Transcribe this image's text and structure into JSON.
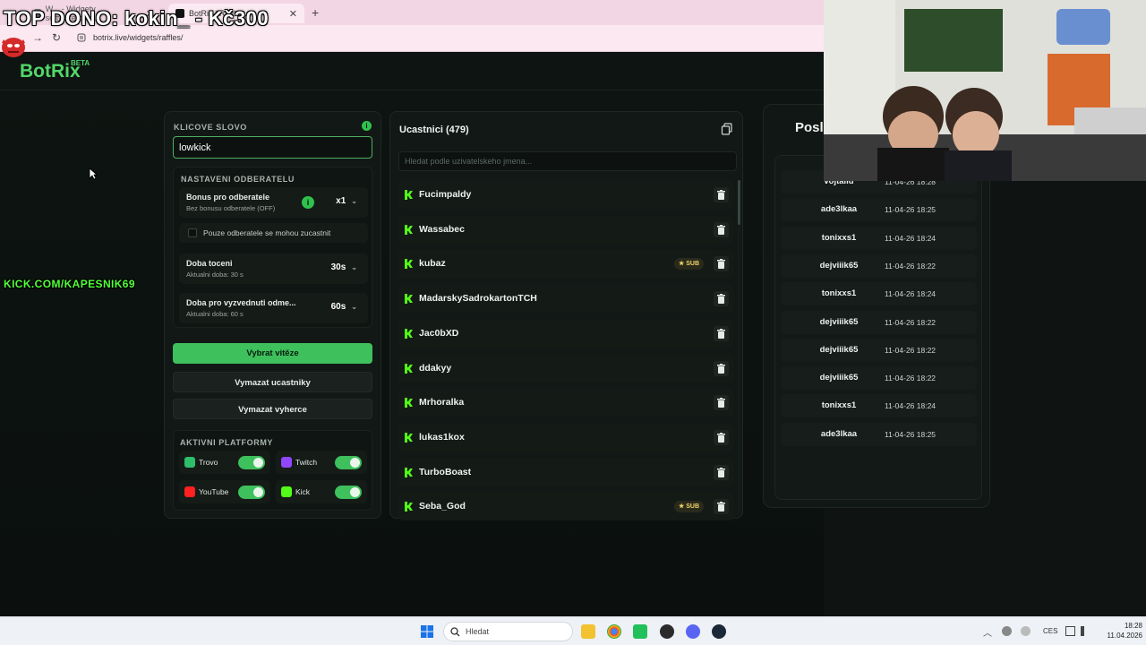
{
  "browser": {
    "tabs": [
      {
        "label": "W... - Widgety ... software pro ..."
      },
      {
        "label": "BotRix | Raffle..."
      }
    ],
    "new_tab": "+",
    "url": "botrix.live/widgets/raffles/"
  },
  "stream_overlay": {
    "top_text": "TOP DONO: kokin_ - Kč300",
    "kick_link": "KICK.COM/KAPESNIK69"
  },
  "app": {
    "logo": "BotRix",
    "beta": "BETA"
  },
  "settings": {
    "keyword_label": "KLICOVE SLOVO",
    "keyword_value": "lowkick",
    "subscriber_settings_label": "NASTAVENI ODBERATELU",
    "bonus": {
      "title": "Bonus pro odberatele",
      "subtitle": "Bez bonusu odberatele (OFF)",
      "value": "x1"
    },
    "sub_only_label": "Pouze odberatele se mohou zucastnit",
    "spin_time": {
      "title": "Doba toceni",
      "subtitle": "Aktualni doba: 30 s",
      "value": "30s"
    },
    "claim_time": {
      "title": "Doba pro vyzvednuti odme...",
      "subtitle": "Aktualni doba: 60 s",
      "value": "60s"
    },
    "pick_winner": "Vybrat vitěze",
    "clear_participants": "Vymazat ucastniky",
    "clear_winners": "Vymazat vyherce",
    "platforms_label": "AKTIVNI PLATFORMY",
    "platforms": [
      {
        "name": "Trovo",
        "color": "#2dbf6a",
        "enabled": true
      },
      {
        "name": "Twitch",
        "color": "#9146ff",
        "enabled": true
      },
      {
        "name": "YouTube",
        "color": "#ff2020",
        "enabled": true
      },
      {
        "name": "Kick",
        "color": "#53fc18",
        "enabled": true
      }
    ]
  },
  "participants": {
    "title": "Ucastnici (479)",
    "search_placeholder": "Hledat podle uzivatelskeho jmena...",
    "sub_badge": "★ SUB",
    "list": [
      {
        "name": "Fucimpaldy",
        "sub": false
      },
      {
        "name": "Wassabec",
        "sub": false
      },
      {
        "name": "kubaz",
        "sub": true
      },
      {
        "name": "MadarskySadrokartonTCH",
        "sub": false
      },
      {
        "name": "Jac0bXD",
        "sub": false
      },
      {
        "name": "ddakyy",
        "sub": false
      },
      {
        "name": "Mrhoralka",
        "sub": false
      },
      {
        "name": "lukas1kox",
        "sub": false
      },
      {
        "name": "TurboBoast",
        "sub": false
      },
      {
        "name": "Seba_God",
        "sub": true
      }
    ]
  },
  "winners": {
    "title": "Posl",
    "list": [
      {
        "name": "vojtalid",
        "time": "11-04-26 18:28"
      },
      {
        "name": "ade3lkaa",
        "time": "11-04-26 18:25"
      },
      {
        "name": "tonixxs1",
        "time": "11-04-26 18:24"
      },
      {
        "name": "dejviiik65",
        "time": "11-04-26 18:22"
      },
      {
        "name": "tonixxs1",
        "time": "11-04-26 18:24"
      },
      {
        "name": "dejviiik65",
        "time": "11-04-26 18:22"
      },
      {
        "name": "dejviiik65",
        "time": "11-04-26 18:22"
      },
      {
        "name": "dejviiik65",
        "time": "11-04-26 18:22"
      },
      {
        "name": "tonixxs1",
        "time": "11-04-26 18:24"
      },
      {
        "name": "ade3lkaa",
        "time": "11-04-26 18:25"
      }
    ]
  },
  "taskbar": {
    "search_text": "Hledat",
    "language": "CES",
    "time": "18:28",
    "date": "11.04.2026"
  }
}
